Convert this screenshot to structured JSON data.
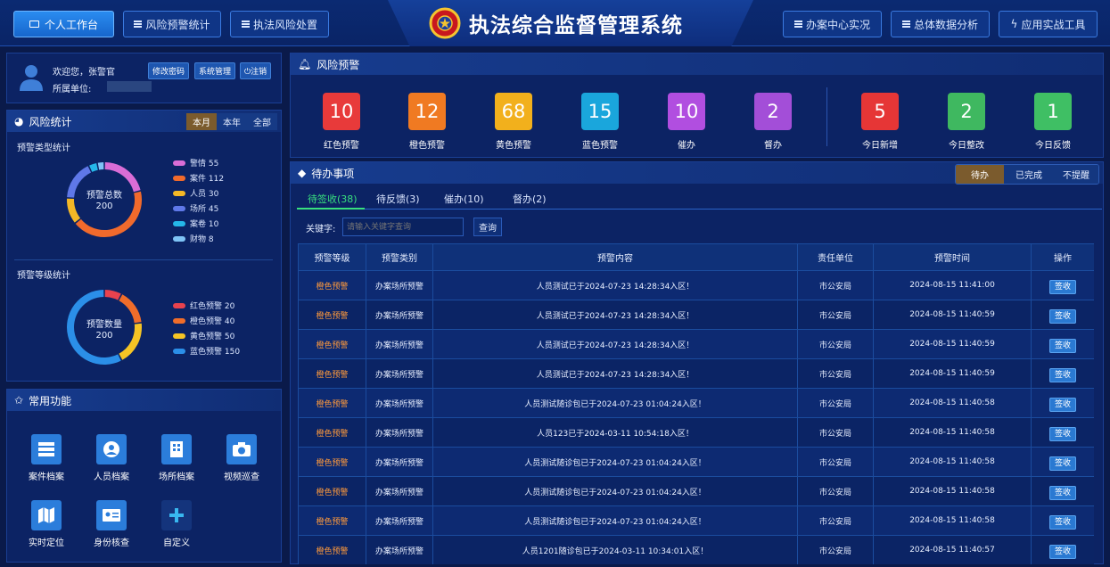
{
  "nav": {
    "left": [
      "个人工作台",
      "风险预警统计",
      "执法风险处置"
    ],
    "right": [
      "办案中心实况",
      "总体数据分析",
      "应用实战工具"
    ],
    "title": "执法综合监督管理系统"
  },
  "user": {
    "welcome": "欢迎您，张警官",
    "unit_label": "所属单位:",
    "change_password": "修改密码",
    "system_admin": "系统管理",
    "logout": "注销"
  },
  "risk_stats": {
    "title": "风险统计",
    "periods": [
      "本月",
      "本年",
      "全部"
    ],
    "type_title": "预警类型统计",
    "type_center_label": "预警总数",
    "type_total": "200",
    "type_legend": [
      {
        "label": "警情 55",
        "value": 55,
        "color": "#d96dd6"
      },
      {
        "label": "案件 112",
        "value": 112,
        "color": "#f16a2c"
      },
      {
        "label": "人员 30",
        "value": 30,
        "color": "#f4b826"
      },
      {
        "label": "场所 45",
        "value": 45,
        "color": "#5f78e8"
      },
      {
        "label": "案卷 10",
        "value": 10,
        "color": "#25b7e8"
      },
      {
        "label": "财物 8",
        "value": 8,
        "color": "#7fc4f6"
      }
    ],
    "level_title": "预警等级统计",
    "level_center_label": "预警数量",
    "level_total": "200",
    "level_legend": [
      {
        "label": "红色预警 20",
        "value": 20,
        "color": "#e8424e"
      },
      {
        "label": "橙色预警 40",
        "value": 40,
        "color": "#f06d2a"
      },
      {
        "label": "黄色预警 50",
        "value": 50,
        "color": "#f5c425"
      },
      {
        "label": "蓝色预警 150",
        "value": 150,
        "color": "#2b8fe8"
      }
    ]
  },
  "common": {
    "title": "常用功能",
    "items": [
      {
        "label": "案件档案",
        "icon": "case-file-icon"
      },
      {
        "label": "人员档案",
        "icon": "person-file-icon"
      },
      {
        "label": "场所档案",
        "icon": "building-file-icon"
      },
      {
        "label": "视频巡查",
        "icon": "camera-icon"
      },
      {
        "label": "实时定位",
        "icon": "map-icon"
      },
      {
        "label": "身份核查",
        "icon": "id-card-icon"
      },
      {
        "label": "自定义",
        "icon": "plus-icon"
      }
    ]
  },
  "warning": {
    "title": "风险预警",
    "items": [
      {
        "value": "10",
        "label": "红色预警",
        "color": "#e83a3a"
      },
      {
        "value": "12",
        "label": "橙色预警",
        "color": "#f07a22"
      },
      {
        "value": "68",
        "label": "黄色预警",
        "color": "#f2b01c"
      },
      {
        "value": "15",
        "label": "蓝色预警",
        "color": "#1aa6dc"
      },
      {
        "value": "10",
        "label": "催办",
        "color": "#b14ee0"
      },
      {
        "value": "2",
        "label": "督办",
        "color": "#a34ed8"
      },
      {
        "value": "5",
        "label": "今日新增",
        "color": "#e63636"
      },
      {
        "value": "2",
        "label": "今日整改",
        "color": "#3fb860"
      },
      {
        "value": "1",
        "label": "今日反馈",
        "color": "#3fbf64"
      }
    ]
  },
  "todo": {
    "title": "待办事项",
    "filters": [
      "待办",
      "已完成",
      "不提醒"
    ],
    "tabs": [
      "待签收(38)",
      "待反馈(3)",
      "催办(10)",
      "督办(2)"
    ],
    "keyword_label": "关键字:",
    "keyword_placeholder": "请输入关键字查询",
    "search_btn": "查询",
    "columns": [
      "预警等级",
      "预警类别",
      "预警内容",
      "责任单位",
      "预警时间",
      "操作"
    ],
    "rows": [
      [
        "橙色预警",
        "办案场所预警",
        "人员测试已于2024-07-23 14:28:34入区！",
        "市公安局",
        "2024-08-15 11:41:00",
        "签收"
      ],
      [
        "橙色预警",
        "办案场所预警",
        "人员测试已于2024-07-23 14:28:34入区！",
        "市公安局",
        "2024-08-15 11:40:59",
        "签收"
      ],
      [
        "橙色预警",
        "办案场所预警",
        "人员测试已于2024-07-23 14:28:34入区！",
        "市公安局",
        "2024-08-15 11:40:59",
        "签收"
      ],
      [
        "橙色预警",
        "办案场所预警",
        "人员测试已于2024-07-23 14:28:34入区！",
        "市公安局",
        "2024-08-15 11:40:59",
        "签收"
      ],
      [
        "橙色预警",
        "办案场所预警",
        "人员测试随诊包已于2024-07-23 01:04:24入区！",
        "市公安局",
        "2024-08-15 11:40:58",
        "签收"
      ],
      [
        "橙色预警",
        "办案场所预警",
        "人员123已于2024-03-11 10:54:18入区！",
        "市公安局",
        "2024-08-15 11:40:58",
        "签收"
      ],
      [
        "橙色预警",
        "办案场所预警",
        "人员测试随诊包已于2024-07-23 01:04:24入区！",
        "市公安局",
        "2024-08-15 11:40:58",
        "签收"
      ],
      [
        "橙色预警",
        "办案场所预警",
        "人员测试随诊包已于2024-07-23 01:04:24入区！",
        "市公安局",
        "2024-08-15 11:40:58",
        "签收"
      ],
      [
        "橙色预警",
        "办案场所预警",
        "人员测试随诊包已于2024-07-23 01:04:24入区！",
        "市公安局",
        "2024-08-15 11:40:58",
        "签收"
      ],
      [
        "橙色预警",
        "办案场所预警",
        "人员1201随诊包已于2024-03-11 10:34:01入区！",
        "市公安局",
        "2024-08-15 11:40:57",
        "签收"
      ]
    ]
  }
}
